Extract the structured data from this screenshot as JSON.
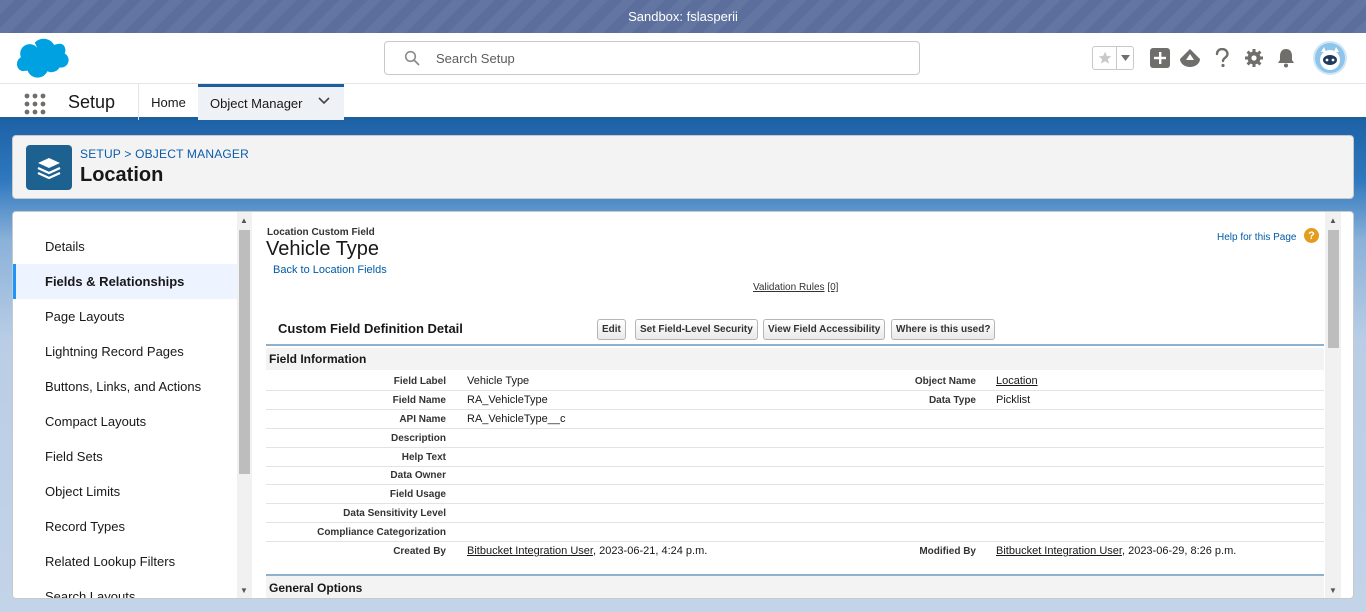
{
  "sandbox": {
    "label": "Sandbox: fslasperii"
  },
  "header": {
    "search_placeholder": "Search Setup",
    "icons": [
      "salesforce-cloud-logo",
      "search-icon",
      "star-icon",
      "chevron-down-icon",
      "plus-icon",
      "trailhead-icon",
      "question-icon",
      "gear-icon",
      "bell-icon",
      "avatar"
    ]
  },
  "nav": {
    "app_name": "Setup",
    "tabs": [
      {
        "label": "Home"
      },
      {
        "label": "Object Manager"
      }
    ]
  },
  "title_card": {
    "breadcrumb": "SETUP > OBJECT MANAGER",
    "title": "Location"
  },
  "sidebar": {
    "items": [
      {
        "label": "Details"
      },
      {
        "label": "Fields & Relationships"
      },
      {
        "label": "Page Layouts"
      },
      {
        "label": "Lightning Record Pages"
      },
      {
        "label": "Buttons, Links, and Actions"
      },
      {
        "label": "Compact Layouts"
      },
      {
        "label": "Field Sets"
      },
      {
        "label": "Object Limits"
      },
      {
        "label": "Record Types"
      },
      {
        "label": "Related Lookup Filters"
      },
      {
        "label": "Search Layouts"
      }
    ]
  },
  "content": {
    "sup_title": "Location Custom Field",
    "title": "Vehicle Type",
    "back_link": "Back to Location Fields",
    "help_link": "Help for this Page",
    "help_icon": "?",
    "validation_rules": "Validation Rules",
    "validation_count": "[0]",
    "detail_heading": "Custom Field Definition Detail",
    "buttons": {
      "edit": "Edit",
      "fls": "Set Field-Level Security",
      "access": "View Field Accessibility",
      "where": "Where is this used?"
    },
    "field_info_heading": "Field Information",
    "rows": [
      {
        "label": "Field Label",
        "value": "Vehicle Type",
        "label2": "Object Name",
        "value2": "Location"
      },
      {
        "label": "Field Name",
        "value": "RA_VehicleType",
        "label2": "Data Type",
        "value2": "Picklist"
      },
      {
        "label": "API Name",
        "value": "RA_VehicleType__c"
      },
      {
        "label": "Description",
        "value": ""
      },
      {
        "label": "Help Text",
        "value": ""
      },
      {
        "label": "Data Owner",
        "value": ""
      },
      {
        "label": "Field Usage",
        "value": ""
      },
      {
        "label": "Data Sensitivity Level",
        "value": ""
      },
      {
        "label": "Compliance Categorization",
        "value": ""
      }
    ],
    "created_by": {
      "label": "Created By",
      "user": "Bitbucket Integration User",
      "date": ", 2023-06-21, 4:24 p.m."
    },
    "modified_by": {
      "label": "Modified By",
      "user": "Bitbucket Integration User",
      "date": ", 2023-06-29, 8:26 p.m."
    },
    "general_options_heading": "General Options"
  },
  "colors": {
    "brand_blue": "#0b5cab",
    "sandbox_bar": "#5b6e9c",
    "object_icon": "#1d6190",
    "active_border": "#1b96ff"
  }
}
